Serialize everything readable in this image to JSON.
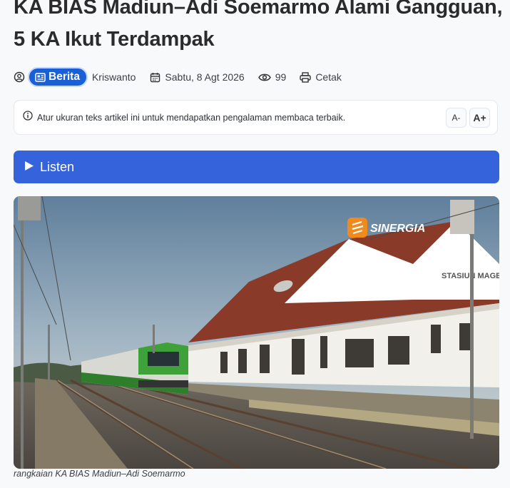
{
  "article": {
    "title": "KA BIAS Madiun–Adi Soemarmo Alami Gangguan, 5 KA Ikut Terdampak",
    "category": "Berita",
    "author": "Kriswanto",
    "date": "Sabtu, 8 Agt 2026",
    "views": "99",
    "print_label": "Cetak"
  },
  "notice": {
    "text": "Atur ukuran teks artikel ini untuk mendapatkan pengalaman membaca terbaik.",
    "decrease_label": "A-",
    "increase_label": "A+"
  },
  "listen": {
    "label": "Listen"
  },
  "image": {
    "watermark": "SINERGIA",
    "station_sign": "STASIUN MAGETAN",
    "caption": "rangkaian KA BIAS Madiun–Adi Soemarmo"
  },
  "colors": {
    "accent": "#3563db",
    "badge": "#1a5fd6"
  }
}
